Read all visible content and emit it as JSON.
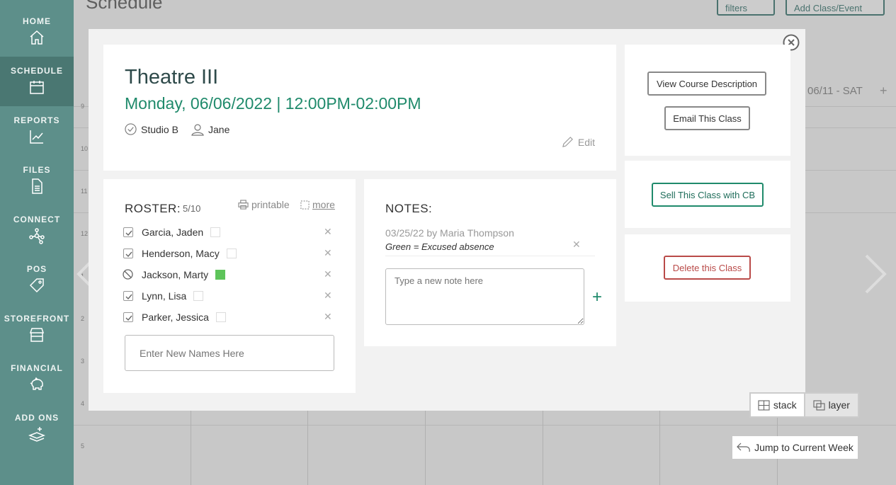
{
  "sidebar": {
    "items": [
      {
        "label": "HOME",
        "icon": "home-icon"
      },
      {
        "label": "SCHEDULE",
        "icon": "calendar-icon",
        "active": true
      },
      {
        "label": "REPORTS",
        "icon": "chart-icon"
      },
      {
        "label": "FILES",
        "icon": "file-icon"
      },
      {
        "label": "CONNECT",
        "icon": "network-icon"
      },
      {
        "label": "POS",
        "icon": "tag-icon"
      },
      {
        "label": "STOREFRONT",
        "icon": "store-icon"
      },
      {
        "label": "FINANCIAL",
        "icon": "piggy-bank-icon"
      },
      {
        "label": "ADD ONS",
        "icon": "layers-plus-icon"
      }
    ]
  },
  "page": {
    "title": "Schedule",
    "filters_label": "filters",
    "add_class_label": "Add Class/Event",
    "day_header": "06/11 - SAT",
    "hours": [
      "9",
      "10",
      "11",
      "12",
      "1",
      "2",
      "3",
      "4",
      "5"
    ]
  },
  "modal": {
    "title": "Theatre III",
    "datetime": "Monday, 06/06/2022 | 12:00PM-02:00PM",
    "location": "Studio B",
    "instructor": "Jane",
    "edit_label": "Edit",
    "roster": {
      "title": "ROSTER:",
      "count": "5/10",
      "printable_label": "printable",
      "more_label": "more",
      "students": [
        {
          "name": "Garcia, Jaden",
          "status": "checked",
          "swatch": "empty"
        },
        {
          "name": "Henderson, Macy",
          "status": "checked",
          "swatch": "empty"
        },
        {
          "name": "Jackson, Marty",
          "status": "absent",
          "swatch": "green"
        },
        {
          "name": "Lynn, Lisa",
          "status": "checked",
          "swatch": "empty"
        },
        {
          "name": "Parker, Jessica",
          "status": "checked",
          "swatch": "empty"
        }
      ],
      "new_names_placeholder": "Enter New Names Here"
    },
    "notes": {
      "title": "NOTES:",
      "entries": [
        {
          "meta": "03/25/22 by Maria Thompson",
          "text": "Green = Excused absence"
        }
      ],
      "new_note_placeholder": "Type a new note here"
    },
    "actions": {
      "view_description": "View Course Description",
      "email_class": "Email This Class",
      "sell_class": "Sell This Class with CB",
      "delete_class": "Delete this Class"
    }
  },
  "view_toggle": {
    "stack_label": "stack",
    "layer_label": "layer",
    "active": "layer"
  },
  "jump_label": "Jump to Current Week",
  "colors": {
    "sidebar": "#5d8f8a",
    "accent_green": "#1f8a6b",
    "danger": "#b94a48",
    "absent_swatch": "#5ec45a"
  }
}
